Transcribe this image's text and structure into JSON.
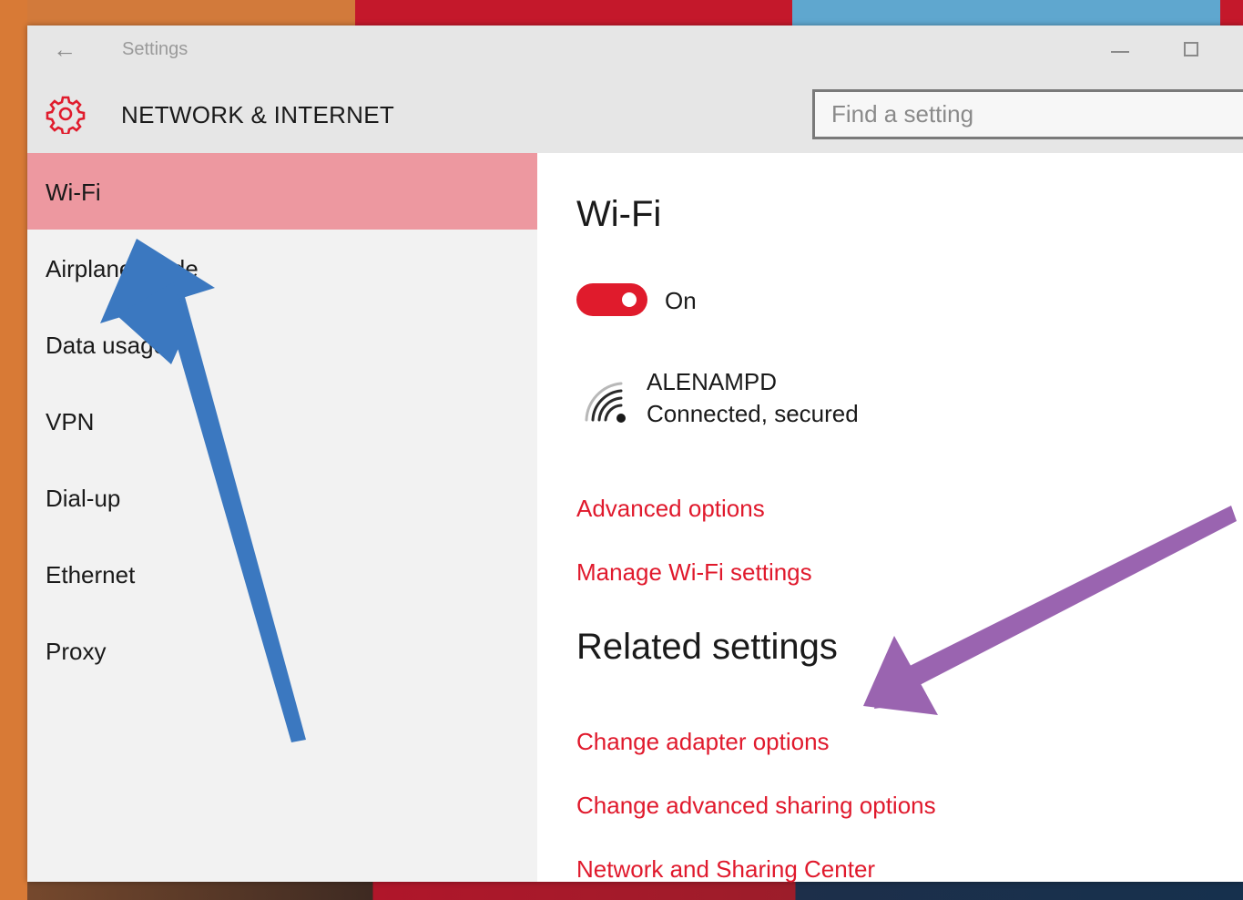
{
  "window": {
    "title": "Settings",
    "back_icon": "back-arrow-icon"
  },
  "header": {
    "title": "NETWORK & INTERNET",
    "icon": "gear-icon",
    "search_placeholder": "Find a setting"
  },
  "sidebar": {
    "items": [
      {
        "label": "Wi-Fi",
        "active": true
      },
      {
        "label": "Airplane mode",
        "active": false
      },
      {
        "label": "Data usage",
        "active": false
      },
      {
        "label": "VPN",
        "active": false
      },
      {
        "label": "Dial-up",
        "active": false
      },
      {
        "label": "Ethernet",
        "active": false
      },
      {
        "label": "Proxy",
        "active": false
      }
    ]
  },
  "main": {
    "title": "Wi-Fi",
    "toggle": {
      "state": "On",
      "on": true
    },
    "network": {
      "name": "ALENAMPD",
      "status": "Connected, secured",
      "icon": "wifi-signal-icon"
    },
    "links": [
      "Advanced options",
      "Manage Wi-Fi settings"
    ],
    "related_title": "Related settings",
    "related_links": [
      "Change adapter options",
      "Change advanced sharing options",
      "Network and Sharing Center"
    ]
  },
  "colors": {
    "accent": "#e01b2c",
    "active_nav": "#ed98a0",
    "annotation_blue": "#3b78c0",
    "annotation_purple": "#9a64b0"
  }
}
